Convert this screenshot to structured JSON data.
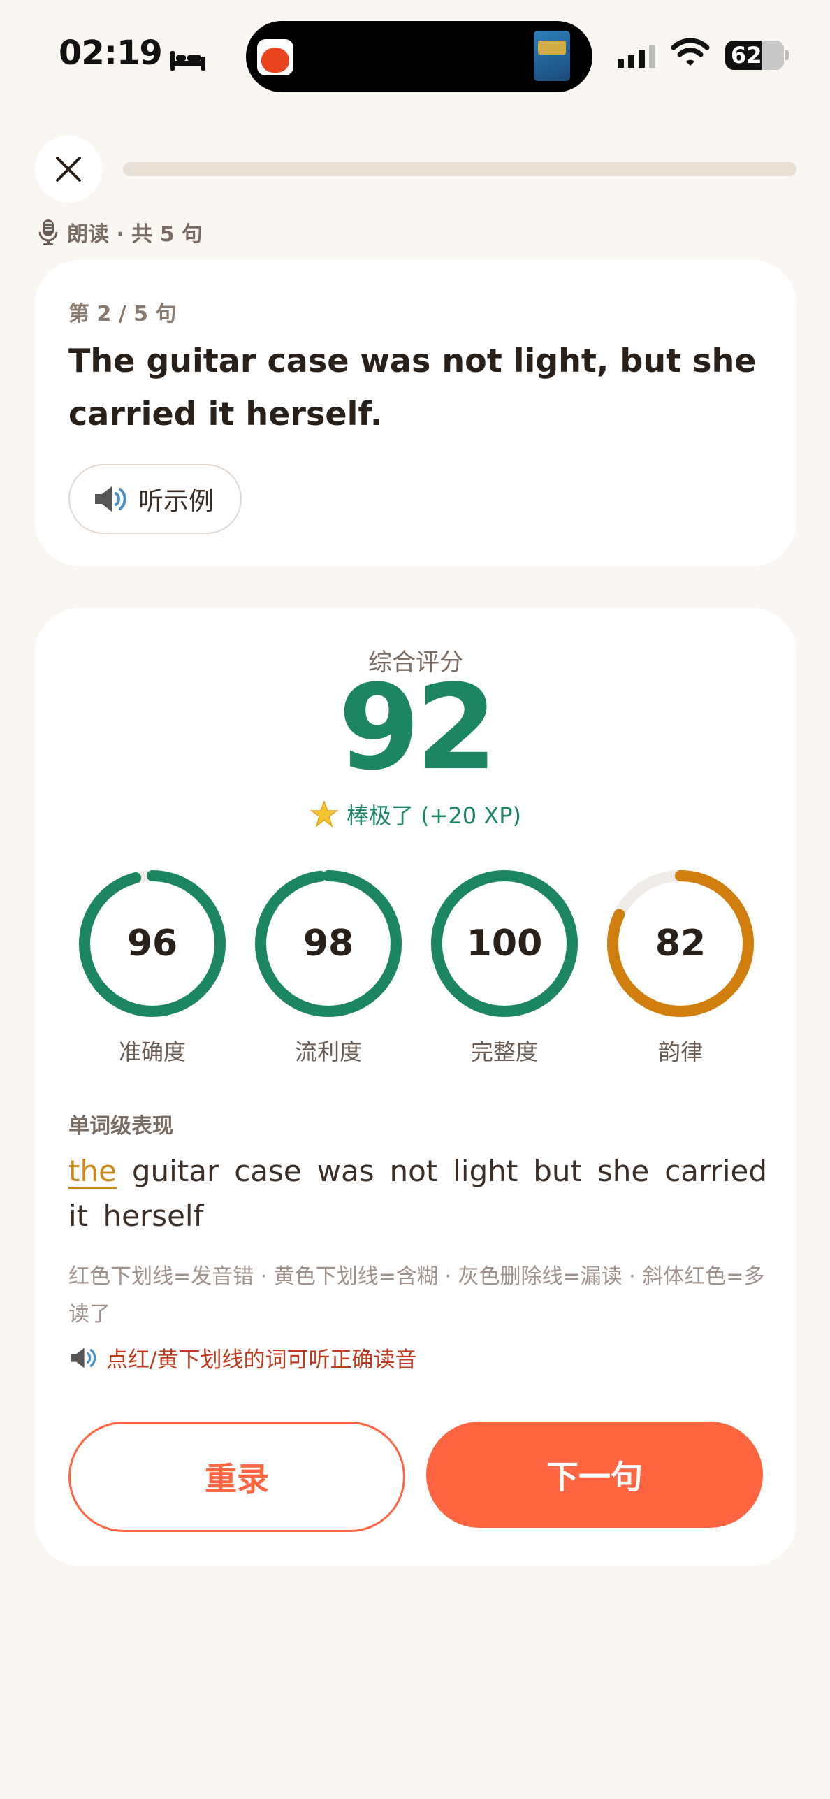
{
  "status": {
    "time": "02:19",
    "battery": "62"
  },
  "header": {
    "mode_label": "朗读 · 共 5 句",
    "progress_fraction": 0.0
  },
  "sentence_card": {
    "index_label": "第 2 / 5 句",
    "sentence": "The guitar case was not light, but she carried it herself.",
    "listen_label": "听示例"
  },
  "score": {
    "label": "综合评分",
    "value": "92",
    "praise": "棒极了 (+20 XP)",
    "metrics": [
      {
        "value": "96",
        "label": "准确度",
        "fraction": 0.96,
        "color": "#1b8660"
      },
      {
        "value": "98",
        "label": "流利度",
        "fraction": 0.98,
        "color": "#1b8660"
      },
      {
        "value": "100",
        "label": "完整度",
        "fraction": 1.0,
        "color": "#1b8660"
      },
      {
        "value": "82",
        "label": "韵律",
        "fraction": 0.82,
        "color": "#d07f0e"
      }
    ]
  },
  "words": {
    "title": "单词级表现",
    "error_word": "the",
    "rest": "guitar case was not light but she carried it herself",
    "legend": "红色下划线=发音错 · 黄色下划线=含糊 · 灰色删除线=漏读 · 斜体红色=多读了",
    "hint": "点红/黄下划线的词可听正确读音"
  },
  "actions": {
    "retry": "重录",
    "next": "下一句"
  }
}
